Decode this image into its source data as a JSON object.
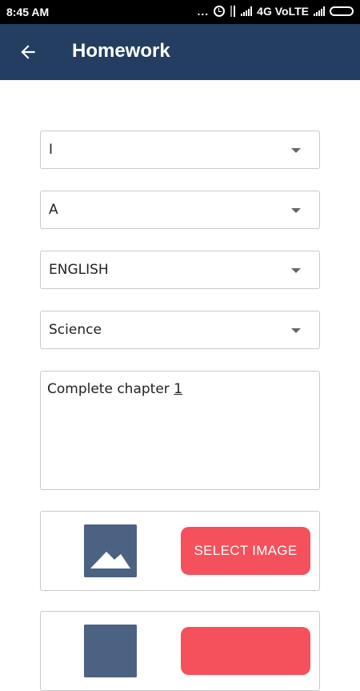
{
  "status_bar": {
    "time": "8:45 AM",
    "dots": "...",
    "network": "4G VoLTE"
  },
  "app_bar": {
    "title": "Homework"
  },
  "form": {
    "class_value": "I",
    "section_value": "A",
    "subject_value": "ENGLISH",
    "topic_value": "Science",
    "description_prefix": "Complete chapter ",
    "description_suffix": "1",
    "select_image_label": "SELECT IMAGE"
  },
  "colors": {
    "app_bar": "#233e61",
    "button": "#f4515d",
    "thumbnail": "#4c6282"
  }
}
